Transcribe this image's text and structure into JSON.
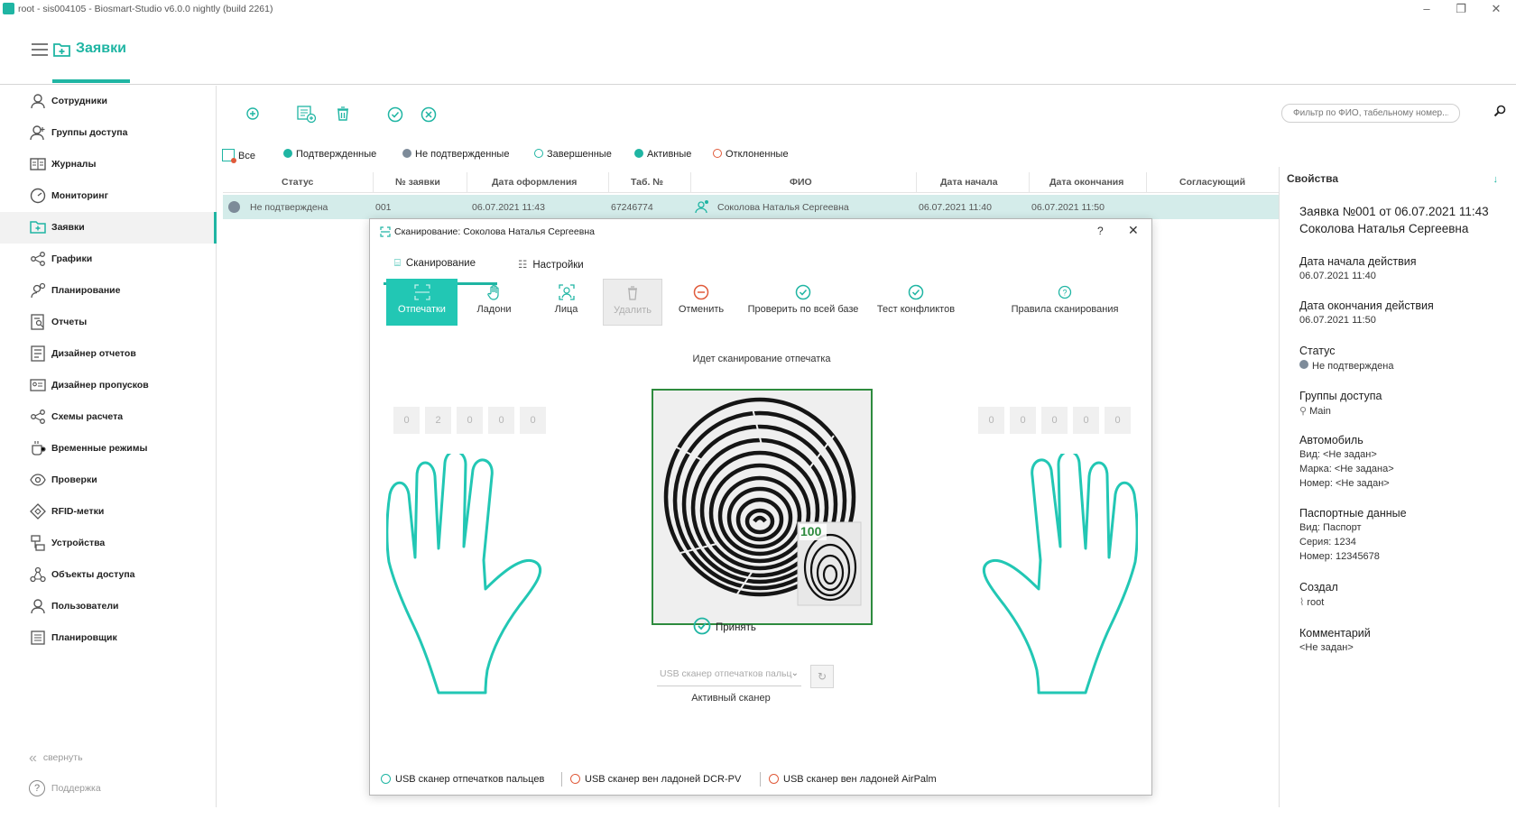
{
  "window": {
    "title": "root - sis004105 - Biosmart-Studio v6.0.0 nightly (build 2261)"
  },
  "header": {
    "title": "Заявки"
  },
  "sidebar": {
    "items": [
      {
        "label": "Сотрудники",
        "icon": "user-icon"
      },
      {
        "label": "Группы доступа",
        "icon": "user-group-icon"
      },
      {
        "label": "Журналы",
        "icon": "journal-icon"
      },
      {
        "label": "Мониторинг",
        "icon": "gauge-icon"
      },
      {
        "label": "Заявки",
        "icon": "folder-plus-icon"
      },
      {
        "label": "Графики",
        "icon": "share-icon"
      },
      {
        "label": "Планирование",
        "icon": "user-planning-icon"
      },
      {
        "label": "Отчеты",
        "icon": "report-icon"
      },
      {
        "label": "Дизайнер отчетов",
        "icon": "report-designer-icon"
      },
      {
        "label": "Дизайнер пропусков",
        "icon": "card-designer-icon"
      },
      {
        "label": "Схемы расчета",
        "icon": "scheme-icon"
      },
      {
        "label": "Временные режимы",
        "icon": "cup-icon"
      },
      {
        "label": "Проверки",
        "icon": "eye-icon"
      },
      {
        "label": "RFID-метки",
        "icon": "tag-icon"
      },
      {
        "label": "Устройства",
        "icon": "devices-icon"
      },
      {
        "label": "Объекты доступа",
        "icon": "objects-icon"
      },
      {
        "label": "Пользователи",
        "icon": "user-outline-icon"
      },
      {
        "label": "Планировщик",
        "icon": "list-icon"
      }
    ],
    "collapse_label": "свернуть",
    "support_label": "Поддержка"
  },
  "toolbar": {
    "search_placeholder": "Фильтр по ФИО, табельному номер..."
  },
  "filters": {
    "all": "Все",
    "confirmed": "Подтвержденные",
    "unconfirmed": "Не подтвержденные",
    "completed": "Завершенные",
    "active": "Активные",
    "rejected": "Отклоненные"
  },
  "table": {
    "columns": [
      "Статус",
      "№ заявки",
      "Дата оформления",
      "Таб. №",
      "ФИО",
      "Дата начала",
      "Дата окончания",
      "Согласующий"
    ],
    "rows": [
      {
        "status": "Не подтверждена",
        "number": "001",
        "date_created": "06.07.2021 11:43",
        "tab": "67246774",
        "fio": "Соколова Наталья Сергеевна",
        "date_start": "06.07.2021 11:40",
        "date_end": "06.07.2021 11:50",
        "approver": ""
      }
    ]
  },
  "properties": {
    "header": "Свойства",
    "title_line1": "Заявка №001 от 06.07.2021 11:43",
    "title_line2": "Соколова Наталья Сергеевна",
    "start_label": "Дата начала действия",
    "start_value": "06.07.2021 11:40",
    "end_label": "Дата окончания действия",
    "end_value": "06.07.2021 11:50",
    "status_label": "Статус",
    "status_value": "Не подтверждена",
    "groups_label": "Группы доступа",
    "groups_value": "Main",
    "car_label": "Автомобиль",
    "car_type": "Вид: <Не задан>",
    "car_brand": "Марка: <Не задана>",
    "car_number": "Номер: <Не задан>",
    "passport_label": "Паспортные данные",
    "passport_type": "Вид: Паспорт",
    "passport_series": "Серия: 1234",
    "passport_number": "Номер: 12345678",
    "created_label": "Создал",
    "created_value": "root",
    "comment_label": "Комментарий",
    "comment_value": "<Не задан>"
  },
  "dialog": {
    "title": "Сканирование: Соколова Наталья Сергеевна",
    "help": "?",
    "tabs": [
      "Сканирование",
      "Настройки"
    ],
    "tools": {
      "prints": "Отпечатки",
      "palms": "Ладони",
      "faces": "Лица",
      "delete": "Удалить",
      "cancel": "Отменить",
      "check_db": "Проверить по всей базе",
      "conflict_test": "Тест конфликтов",
      "rules": "Правила сканирования"
    },
    "scan_status": "Идет сканирование отпечатка",
    "left_digits": [
      "0",
      "2",
      "0",
      "0",
      "0"
    ],
    "right_digits": [
      "0",
      "0",
      "0",
      "0",
      "0"
    ],
    "quality": "100",
    "accept": "Принять",
    "scanner_select": "USB сканер отпечатков пальц",
    "active_scanner_label": "Активный сканер",
    "status_bar": [
      {
        "label": "USB сканер отпечатков пальцев",
        "state": "ok"
      },
      {
        "label": "USB сканер вен ладоней DCR-PV",
        "state": "error"
      },
      {
        "label": "USB сканер вен ладоней AirPalm",
        "state": "error"
      }
    ],
    "colors": {
      "accent": "#1fb5a3",
      "error": "#e05a3a",
      "frame": "#2e8b3e"
    }
  }
}
